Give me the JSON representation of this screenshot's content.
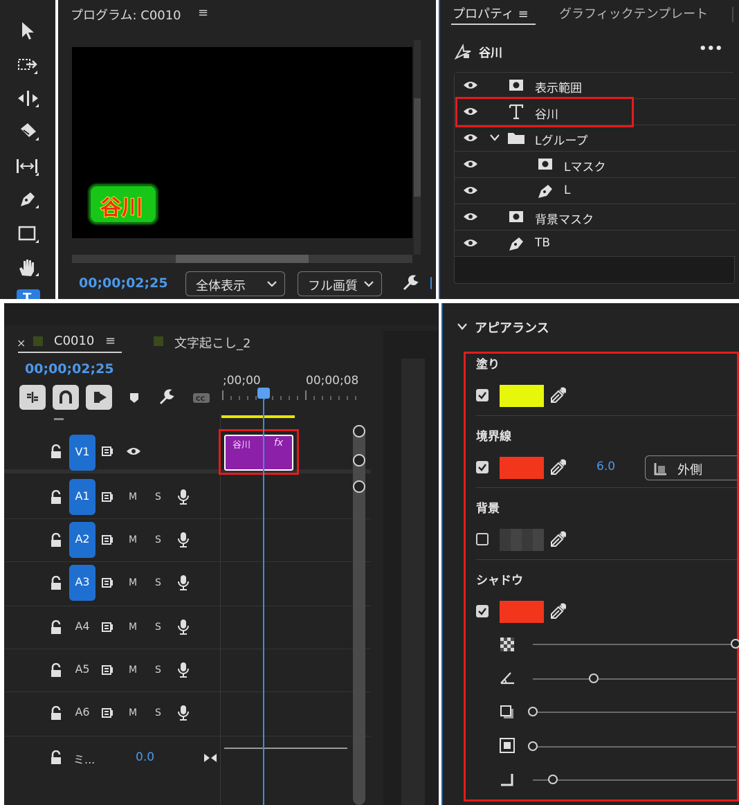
{
  "program_monitor": {
    "title": "プログラム: C0010",
    "menu_icon": "≡",
    "title_card_text": "谷川",
    "timecode": "00;00;02;25",
    "zoom_select": "全体表示",
    "quality_select": "フル画質"
  },
  "properties": {
    "tab_properties": "プロパティ",
    "tab_menu": "≡",
    "tab_graphic_template": "グラフィックテンプレート",
    "layer_name": "谷川",
    "more": "•••",
    "layers": [
      {
        "name": "表示範囲",
        "icon": "mask-icon"
      },
      {
        "name": "谷川",
        "icon": "text-icon"
      },
      {
        "name": "Lグループ",
        "icon": "folder-icon"
      },
      {
        "name": "Lマスク",
        "icon": "mask-icon"
      },
      {
        "name": "L",
        "icon": "pen-icon"
      },
      {
        "name": "背景マスク",
        "icon": "mask-icon"
      },
      {
        "name": "TB",
        "icon": "pen-icon"
      }
    ]
  },
  "timeline": {
    "close": "×",
    "sequence_name": "C0010",
    "sequence_menu": "≡",
    "sequence2_name": "文字起こし_2",
    "timecode": "00;00;02;25",
    "ruler_start": ";00;00",
    "ruler_next": "00;00;08",
    "clip_name": "谷川",
    "clip_fx": "fx",
    "tracks": [
      {
        "name": "V1",
        "active": true
      },
      {
        "name": "A1",
        "active": true
      },
      {
        "name": "A2",
        "active": true
      },
      {
        "name": "A3",
        "active": true
      },
      {
        "name": "A4",
        "active": false
      },
      {
        "name": "A5",
        "active": false
      },
      {
        "name": "A6",
        "active": false
      }
    ],
    "m_label": "M",
    "s_label": "S",
    "mix_name": "ミ...",
    "mix_value": "0.0"
  },
  "appearance": {
    "title": "アピアランス",
    "fill_label": "塗り",
    "fill_checked": true,
    "fill_color": "#e7f70b",
    "stroke_label": "境界線",
    "stroke_checked": true,
    "stroke_color": "#f2361c",
    "stroke_width": "6.0",
    "stroke_position": "外側",
    "background_label": "背景",
    "background_checked": false,
    "shadow_label": "シャドウ",
    "shadow_checked": true,
    "shadow_color": "#f2361c",
    "shadow_opacity": 1.0,
    "shadow_angle": 0.3,
    "shadow_distance": 0.0,
    "shadow_size": 0.0,
    "shadow_blur": 0.1
  },
  "colors": {
    "accent_blue": "#1f6fd1",
    "timecode_blue": "#4c98ea",
    "highlight_red": "#e21c1c",
    "clip_purple": "#8d20a8"
  }
}
